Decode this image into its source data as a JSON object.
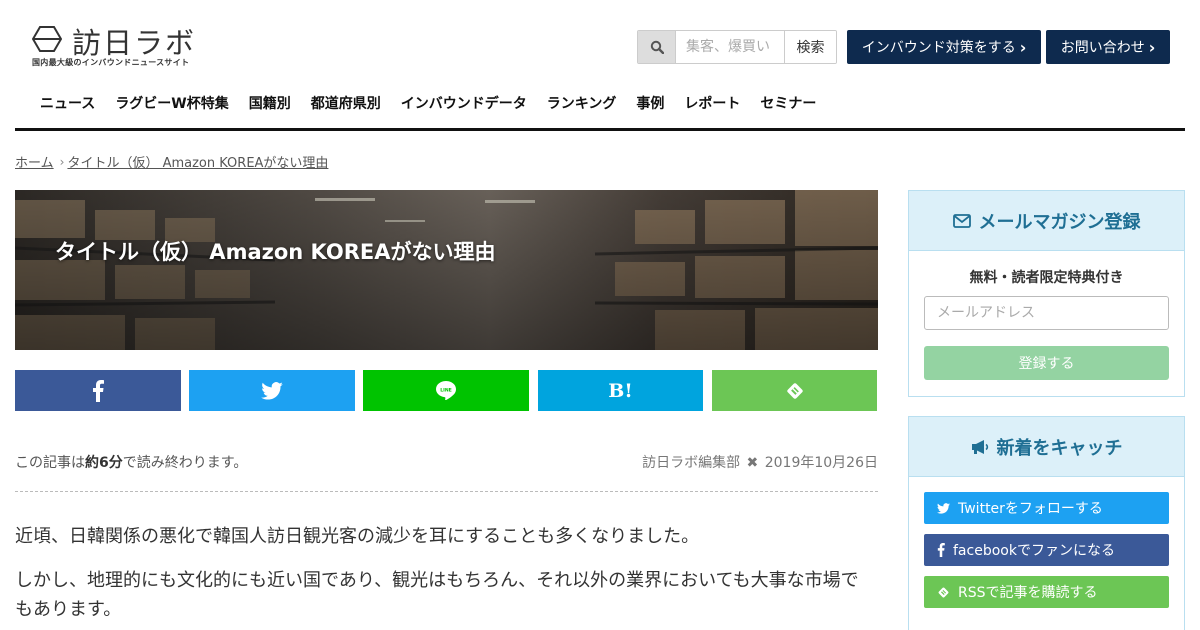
{
  "header": {
    "logo_title": "訪日ラボ",
    "logo_subtitle": "国内最大級のインバウンドニュースサイト",
    "search_icon": "search-icon",
    "search_placeholder": "集客、爆買い",
    "search_button": "検索",
    "inbound_button": "インバウンド対策をする",
    "contact_button": "お問い合わせ",
    "brand_color": "#0e2a4e"
  },
  "nav": {
    "items": [
      "ニュース",
      "ラグビーW杯特集",
      "国籍別",
      "都道府県別",
      "インバウンドデータ",
      "ランキング",
      "事例",
      "レポート",
      "セミナー"
    ]
  },
  "breadcrumb": {
    "home": "ホーム",
    "current": "タイトル（仮） Amazon KOREAがない理由"
  },
  "article": {
    "title": "タイトル（仮） Amazon KOREAがない理由",
    "readtime_prefix": "この記事は",
    "readtime_value": "約6分",
    "readtime_suffix": "で読み終わります。",
    "author": "訪日ラボ編集部",
    "date": "2019年10月26日",
    "paragraphs": [
      "近頃、日韓関係の悪化で韓国人訪日観光客の減少を耳にすることも多くなりました。",
      "しかし、地理的にも文化的にも近い国であり、観光はもちろん、それ以外の業界においても大事な市場でもあります。"
    ]
  },
  "share": {
    "facebook_icon": "facebook-icon",
    "twitter_icon": "twitter-icon",
    "line_icon": "line-icon",
    "hatena_label": "B!",
    "feedly_icon": "feedly-icon",
    "colors": {
      "facebook": "#3b5998",
      "twitter": "#1da1f2",
      "line": "#00c300",
      "hatena": "#00a4de",
      "feedly": "#6cc655"
    }
  },
  "sidebar": {
    "mail": {
      "title": "メールマガジン登録",
      "subtitle": "無料・読者限定特典付き",
      "placeholder": "メールアドレス",
      "button": "登録する"
    },
    "catch": {
      "title": "新着をキャッチ",
      "twitter": "Twitterをフォローする",
      "facebook": "facebookでファンになる",
      "rss": "RSSで記事を購読する"
    }
  }
}
